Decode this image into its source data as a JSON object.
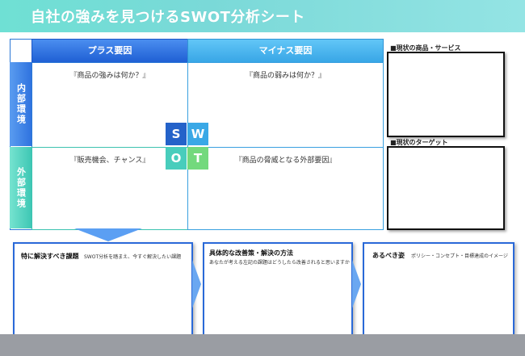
{
  "banner": {
    "title": "自社の強みを見つけるSWOT分析シート"
  },
  "grid": {
    "col_plus": "プラス要因",
    "col_minus": "マイナス要因",
    "row_internal": "内部環境",
    "row_external": "外部環境",
    "strength_prompt": "『商品の強みは何か？』",
    "weakness_prompt": "『商品の弱みは何か？』",
    "opportunity_prompt": "『販売機会、チャンス』",
    "threat_prompt": "『商品の脅威となる外部要因』"
  },
  "swot_letters": {
    "s": "S",
    "w": "W",
    "o": "O",
    "t": "T"
  },
  "right_panel": {
    "current_products_label": "■現状の商品・サービス",
    "current_target_label": "■現状のターゲット"
  },
  "bottom": {
    "issue_title": "特に解決すべき課題",
    "issue_sub": "SWOT分析を踏まえ、今すぐ解決したい課題",
    "solution_title": "具体的な改善策・解決の方法",
    "solution_sub": "あなたが考える左記の課題はどうしたら改善されると思いますか",
    "ideal_title": "あるべき姿",
    "ideal_sub": "ポリシー・コンセプト・目標達成のイメージ"
  },
  "colors": {
    "banner": "#7ad9d8",
    "plus_header": "#1f5fd4",
    "minus_header": "#38a6e6",
    "internal": "#2f73df",
    "external": "#3ec7b4",
    "footer": "#9a9da3"
  }
}
